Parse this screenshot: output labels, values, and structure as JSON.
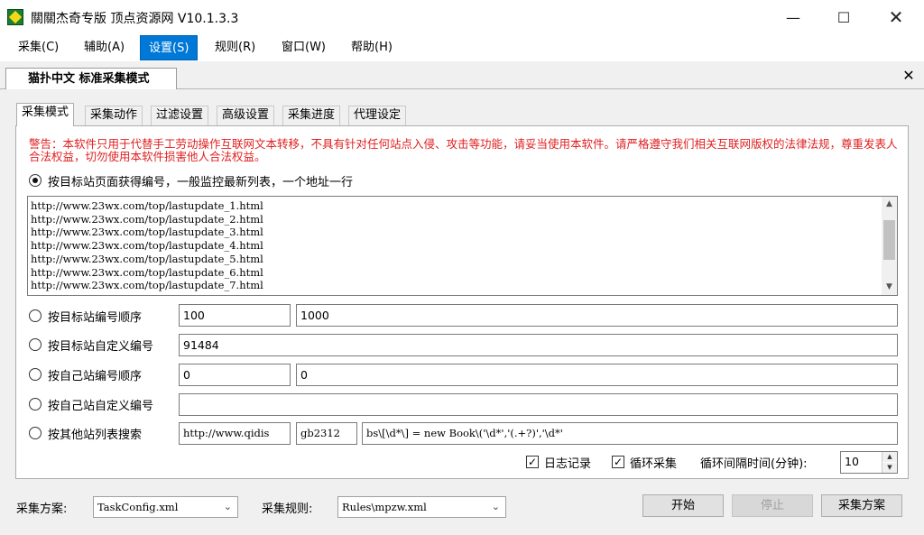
{
  "window": {
    "title": "關關杰奇专版 顶点资源网 V10.1.3.3"
  },
  "menu": {
    "items": [
      "采集(C)",
      "辅助(A)",
      "设置(S)",
      "规则(R)",
      "窗口(W)",
      "帮助(H)"
    ],
    "active": 2
  },
  "doc_tab": {
    "label": "猫扑中文 标准采集模式"
  },
  "tabs": [
    "采集模式",
    "采集动作",
    "过滤设置",
    "高级设置",
    "采集进度",
    "代理设定"
  ],
  "active_tab": 0,
  "warning": "警告：本软件只用于代替手工劳动操作互联网文本转移，不具有针对任何站点入侵、攻击等功能，请妥当使用本软件。请严格遵守我们相关互联网版权的法律法规，尊重发表人合法权益，切勿使用本软件损害他人合法权益。",
  "options": {
    "list_mode": "按目标站页面获得编号，一般监控最新列表，一个地址一行",
    "target_seq": "按目标站编号顺序",
    "target_custom": "按目标站自定义编号",
    "own_seq": "按自己站编号顺序",
    "own_custom": "按自己站自定义编号",
    "other_search": "按其他站列表搜索"
  },
  "urls": [
    "http://www.23wx.com/top/lastupdate_1.html",
    "http://www.23wx.com/top/lastupdate_2.html",
    "http://www.23wx.com/top/lastupdate_3.html",
    "http://www.23wx.com/top/lastupdate_4.html",
    "http://www.23wx.com/top/lastupdate_5.html",
    "http://www.23wx.com/top/lastupdate_6.html",
    "http://www.23wx.com/top/lastupdate_7.html"
  ],
  "fields": {
    "target_start": "100",
    "target_end": "1000",
    "target_custom": "91484",
    "own_start": "0",
    "own_end": "0",
    "own_custom": "",
    "search_url": "http://www.qidis",
    "search_encoding": "gb2312",
    "search_regex": "bs\\[\\d*\\] = new Book\\('\\d*','(.+?)','\\d*'"
  },
  "checks": {
    "log_label": "日志记录",
    "loop_label": "循环采集"
  },
  "interval": {
    "label": "循环间隔时间(分钟):",
    "value": "10"
  },
  "bottom": {
    "plan_label": "采集方案:",
    "plan_value": "TaskConfig.xml",
    "rule_label": "采集规则:",
    "rule_value": "Rules\\mpzw.xml",
    "start_btn": "开始",
    "stop_btn": "停止",
    "plan_btn": "采集方案"
  }
}
